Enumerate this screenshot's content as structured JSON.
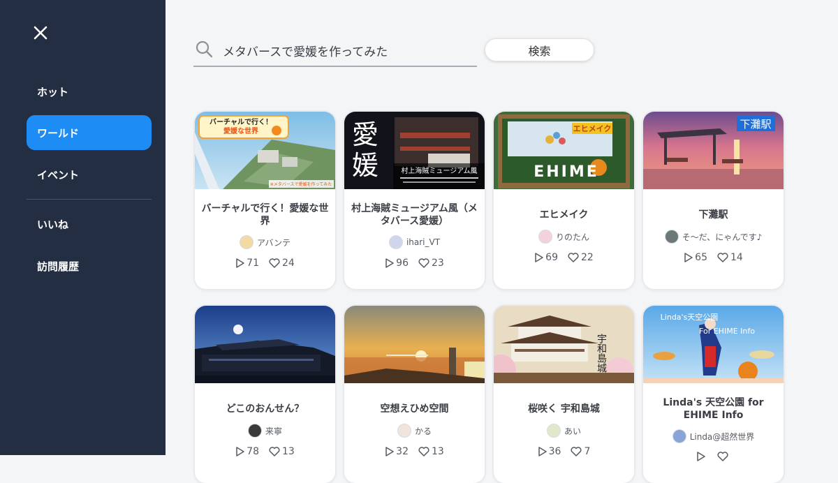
{
  "sidebar": {
    "close_icon": "close-icon",
    "items": [
      {
        "label": "ホット"
      },
      {
        "label": "ワールド"
      },
      {
        "label": "イベント"
      },
      {
        "label": "いいね"
      },
      {
        "label": "訪問履歴"
      }
    ],
    "active_item": "ワールド",
    "background": "#242e42",
    "accent": "#1e8cf5"
  },
  "search": {
    "icon": "search-icon",
    "value": "メタバースで愛媛を作ってみた",
    "button_label": "検索"
  },
  "worlds": [
    {
      "title": "バーチャルで行く！愛媛な世界",
      "author": "アバンテ",
      "plays": "71",
      "likes": "24",
      "thumb_texts": [
        "バーチャルで行く！",
        "愛媛な世界",
        "※メタバースで愛媛を作ってみた"
      ]
    },
    {
      "title": "村上海賊ミュージアム風（メタバース愛媛）",
      "author": "ihari_VT",
      "plays": "96",
      "likes": "23",
      "thumb_texts": [
        "愛",
        "媛",
        "村上海賊ミュージアム風"
      ]
    },
    {
      "title": "エヒメイク",
      "author": "りのたん",
      "plays": "69",
      "likes": "22",
      "thumb_texts": [
        "エヒメイク",
        "EHIME"
      ]
    },
    {
      "title": "下灘駅",
      "author": "そ〜だ、にゃんです♪",
      "plays": "65",
      "likes": "14",
      "thumb_texts": [
        "下灘駅"
      ]
    },
    {
      "title": "どこのおんせん？",
      "author": "来寧",
      "plays": "78",
      "likes": "13",
      "thumb_texts": []
    },
    {
      "title": "空想えひめ空間",
      "author": "かる",
      "plays": "32",
      "likes": "13",
      "thumb_texts": []
    },
    {
      "title": "桜咲く 宇和島城",
      "author": "あい",
      "plays": "36",
      "likes": "7",
      "thumb_texts": [
        "宇和島城"
      ]
    },
    {
      "title": "Linda's 天空公園 for EHIME Info",
      "author": "Linda@超然世界",
      "plays": "",
      "likes": "",
      "thumb_texts": [
        "Linda's天空公園",
        "For EHIME Info"
      ]
    }
  ]
}
